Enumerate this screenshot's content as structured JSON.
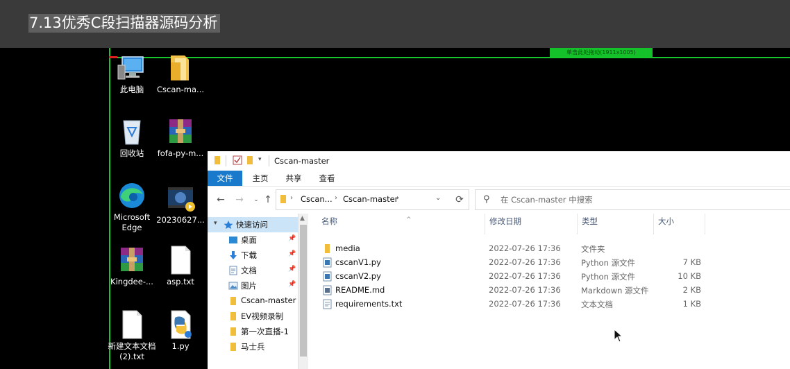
{
  "video_title": "7.13优秀C段扫描器源码分析",
  "capture_overlay": {
    "drag_label": "单击此处拖动(1911x1005)"
  },
  "desktop_icons": [
    {
      "label": "此电脑",
      "icon": "this-pc-icon"
    },
    {
      "label": "Cscan-ma...",
      "icon": "folder-icon"
    },
    {
      "label": "回收站",
      "icon": "recycle-bin-icon"
    },
    {
      "label": "fofa-py-m...",
      "icon": "winrar-archive-icon"
    },
    {
      "label": "Microsoft",
      "label2": "Edge",
      "icon": "edge-icon"
    },
    {
      "label": "20230627...",
      "icon": "video-file-icon"
    },
    {
      "label": "Kingdee-...",
      "icon": "winrar-archive-icon"
    },
    {
      "label": "asp.txt",
      "icon": "text-file-icon"
    },
    {
      "label": "新建文本文档",
      "label2": "(2).txt",
      "icon": "text-file-icon"
    },
    {
      "label": "1.py",
      "icon": "python-file-icon"
    }
  ],
  "explorer": {
    "window_title": "Cscan-master",
    "ribbon_tabs": [
      "文件",
      "主页",
      "共享",
      "查看"
    ],
    "breadcrumb": [
      "Cscan...",
      "Cscan-master"
    ],
    "search_placeholder": "在 Cscan-master 中搜索",
    "nav_pane": [
      {
        "label": "快速访问",
        "icon": "star-icon",
        "pinned": false
      },
      {
        "label": "桌面",
        "icon": "desktop-folder-icon",
        "pinned": true
      },
      {
        "label": "下载",
        "icon": "download-arrow-icon",
        "pinned": true
      },
      {
        "label": "文档",
        "icon": "documents-icon",
        "pinned": true
      },
      {
        "label": "图片",
        "icon": "pictures-icon",
        "pinned": true
      },
      {
        "label": "Cscan-master",
        "icon": "folder-icon",
        "pinned": false
      },
      {
        "label": "EV视频录制",
        "icon": "folder-icon",
        "pinned": false
      },
      {
        "label": "第一次直播-1",
        "icon": "folder-icon",
        "pinned": false
      },
      {
        "label": "马士兵",
        "icon": "folder-icon",
        "pinned": false
      }
    ],
    "columns": {
      "name": "名称",
      "date": "修改日期",
      "type": "类型",
      "size": "大小"
    },
    "files": [
      {
        "name": "media",
        "date": "2022-07-26 17:36",
        "type": "文件夹",
        "size": "",
        "icon": "folder-icon"
      },
      {
        "name": "cscanV1.py",
        "date": "2022-07-26 17:36",
        "type": "Python 源文件",
        "size": "7 KB",
        "icon": "python-file-icon"
      },
      {
        "name": "cscanV2.py",
        "date": "2022-07-26 17:36",
        "type": "Python 源文件",
        "size": "10 KB",
        "icon": "python-file-icon"
      },
      {
        "name": "README.md",
        "date": "2022-07-26 17:36",
        "type": "Markdown 源文件",
        "size": "2 KB",
        "icon": "markdown-file-icon"
      },
      {
        "name": "requirements.txt",
        "date": "2022-07-26 17:36",
        "type": "文本文档",
        "size": "1 KB",
        "icon": "text-file-icon"
      }
    ]
  }
}
